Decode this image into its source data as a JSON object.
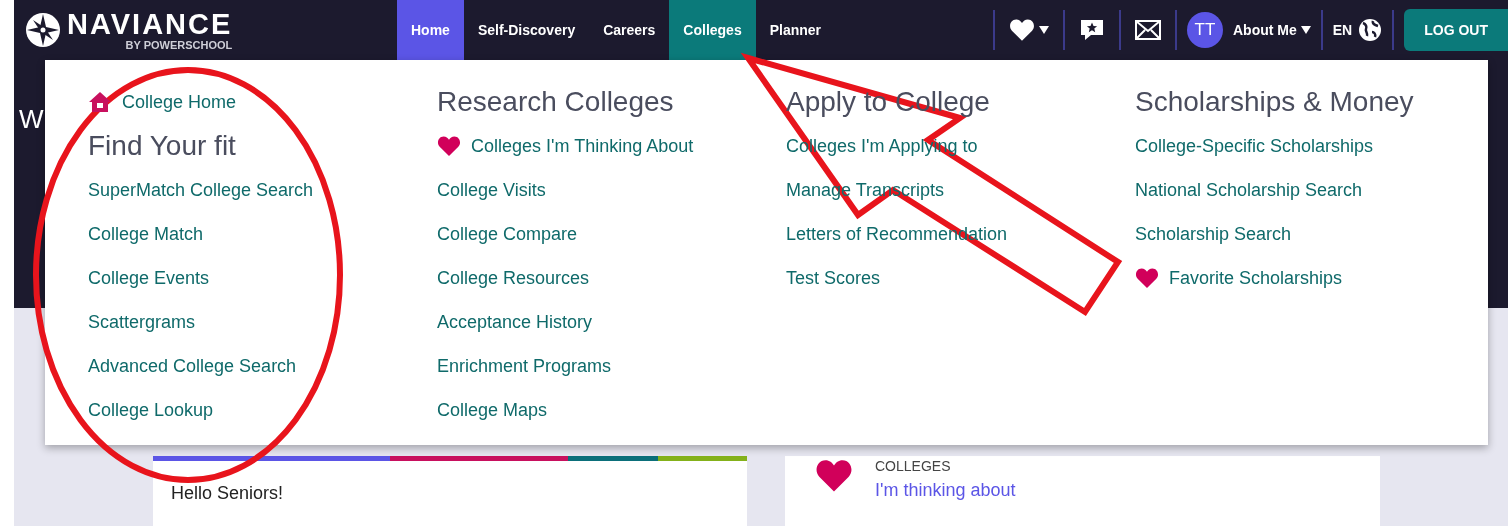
{
  "brand": {
    "name": "NAVIANCE",
    "tagline": "BY POWERSCHOOL"
  },
  "nav": [
    {
      "label": "Home",
      "selected": true,
      "expanded": false
    },
    {
      "label": "Self-Discovery",
      "selected": false,
      "expanded": false
    },
    {
      "label": "Careers",
      "selected": false,
      "expanded": false
    },
    {
      "label": "Colleges",
      "selected": false,
      "expanded": true
    },
    {
      "label": "Planner",
      "selected": false,
      "expanded": false
    }
  ],
  "account": {
    "avatar": "TT",
    "profile": "About Me",
    "language": "EN",
    "logout": "LOG OUT"
  },
  "page_heading": "W",
  "menu": {
    "columns": [
      {
        "items": [
          {
            "kind": "home",
            "label": "College Home"
          },
          {
            "kind": "heading",
            "label": "Find Your fit"
          },
          {
            "kind": "link",
            "label": "SuperMatch College Search"
          },
          {
            "kind": "link",
            "label": "College Match"
          },
          {
            "kind": "link",
            "label": "College Events"
          },
          {
            "kind": "link",
            "label": "Scattergrams"
          },
          {
            "kind": "link",
            "label": "Advanced College Search"
          },
          {
            "kind": "link",
            "label": "College Lookup"
          }
        ]
      },
      {
        "items": [
          {
            "kind": "heading",
            "label": "Research Colleges"
          },
          {
            "kind": "favorite",
            "label": "Colleges I'm Thinking About"
          },
          {
            "kind": "link",
            "label": "College Visits"
          },
          {
            "kind": "link",
            "label": "College Compare"
          },
          {
            "kind": "link",
            "label": "College Resources"
          },
          {
            "kind": "link",
            "label": "Acceptance History"
          },
          {
            "kind": "link",
            "label": "Enrichment Programs"
          },
          {
            "kind": "link",
            "label": "College Maps"
          }
        ]
      },
      {
        "items": [
          {
            "kind": "heading",
            "label": "Apply to College"
          },
          {
            "kind": "link",
            "label": "Colleges I'm Applying to"
          },
          {
            "kind": "link",
            "label": "Manage Transcripts"
          },
          {
            "kind": "link",
            "label": "Letters of Recommendation"
          },
          {
            "kind": "link",
            "label": "Test Scores"
          }
        ]
      },
      {
        "items": [
          {
            "kind": "heading",
            "label": "Scholarships & Money"
          },
          {
            "kind": "link",
            "label": "College-Specific Scholarships"
          },
          {
            "kind": "link",
            "label": "National Scholarship Search"
          },
          {
            "kind": "link",
            "label": "Scholarship Search"
          },
          {
            "kind": "favorite",
            "label": "Favorite Scholarships"
          }
        ]
      }
    ]
  },
  "cards": [
    {
      "kind": "message",
      "text": "Hello Seniors!"
    },
    {
      "kind": "favorites",
      "label": "COLLEGES",
      "link": "I'm thinking about"
    }
  ]
}
